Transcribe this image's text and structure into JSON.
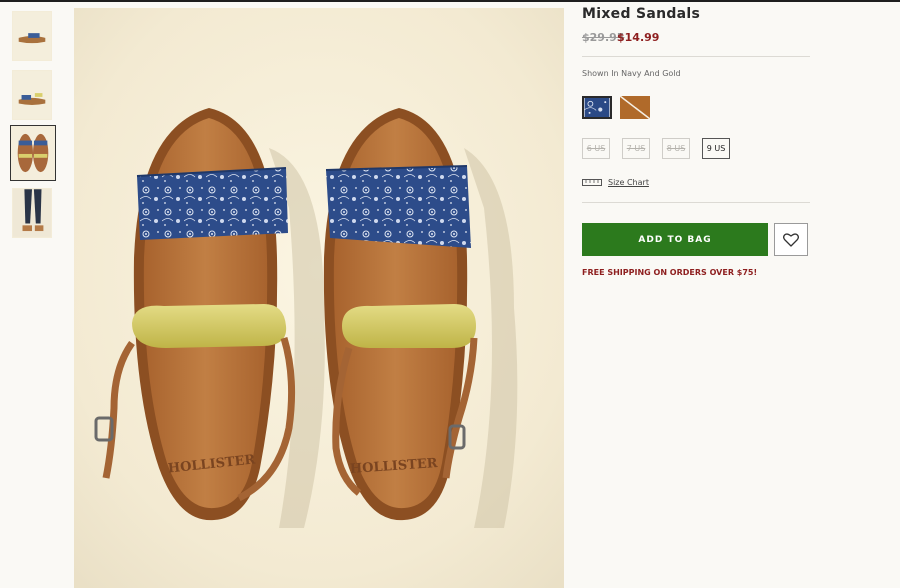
{
  "product": {
    "title": "Mixed Sandals",
    "old_price": "$29.95",
    "sale_price": "$14.99",
    "shown_in": "Shown In Navy And Gold"
  },
  "swatches": [
    {
      "name": "Navy And Gold",
      "color": "#2b4a86",
      "selected": true
    },
    {
      "name": "Tan",
      "color": "#b06a2a",
      "selected": false
    }
  ],
  "sizes": [
    {
      "label": "6 US",
      "available": false
    },
    {
      "label": "7 US",
      "available": false
    },
    {
      "label": "8 US",
      "available": false
    },
    {
      "label": "9 US",
      "available": true
    }
  ],
  "size_chart_label": "Size Chart",
  "add_to_bag_label": "ADD TO BAG",
  "shipping_notice": "FREE SHIPPING ON ORDERS OVER $75!",
  "icons": {
    "wishlist": "heart-icon",
    "size_chart": "ruler-icon"
  },
  "colors": {
    "accent_green": "#2c7a1d",
    "sale_red": "#8e1f1f",
    "background": "#faf9f5"
  },
  "thumbnail_count": 4,
  "active_thumbnail_index": 2
}
